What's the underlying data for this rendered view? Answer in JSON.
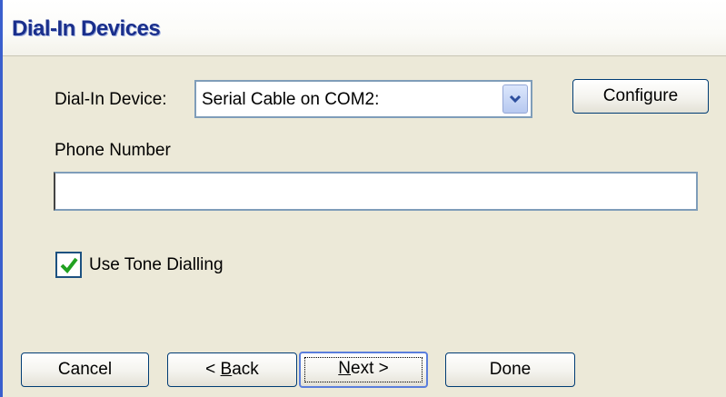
{
  "window": {
    "title": "Dial-In Devices"
  },
  "device": {
    "label": "Dial-In Device:",
    "selected": "Serial Cable on COM2:",
    "configure_label": "Configure"
  },
  "phone": {
    "label": "Phone Number",
    "value": ""
  },
  "tone": {
    "label": "Use Tone Dialling",
    "checked": true
  },
  "footer": {
    "cancel": "Cancel",
    "back_prefix": "< ",
    "back_mnemonic": "B",
    "back_rest": "ack",
    "next_mnemonic": "N",
    "next_rest": "ext >",
    "done": "Done"
  },
  "colors": {
    "title": "#1a2f8c",
    "window_bg": "#ece9d8",
    "check": "#21a121"
  }
}
